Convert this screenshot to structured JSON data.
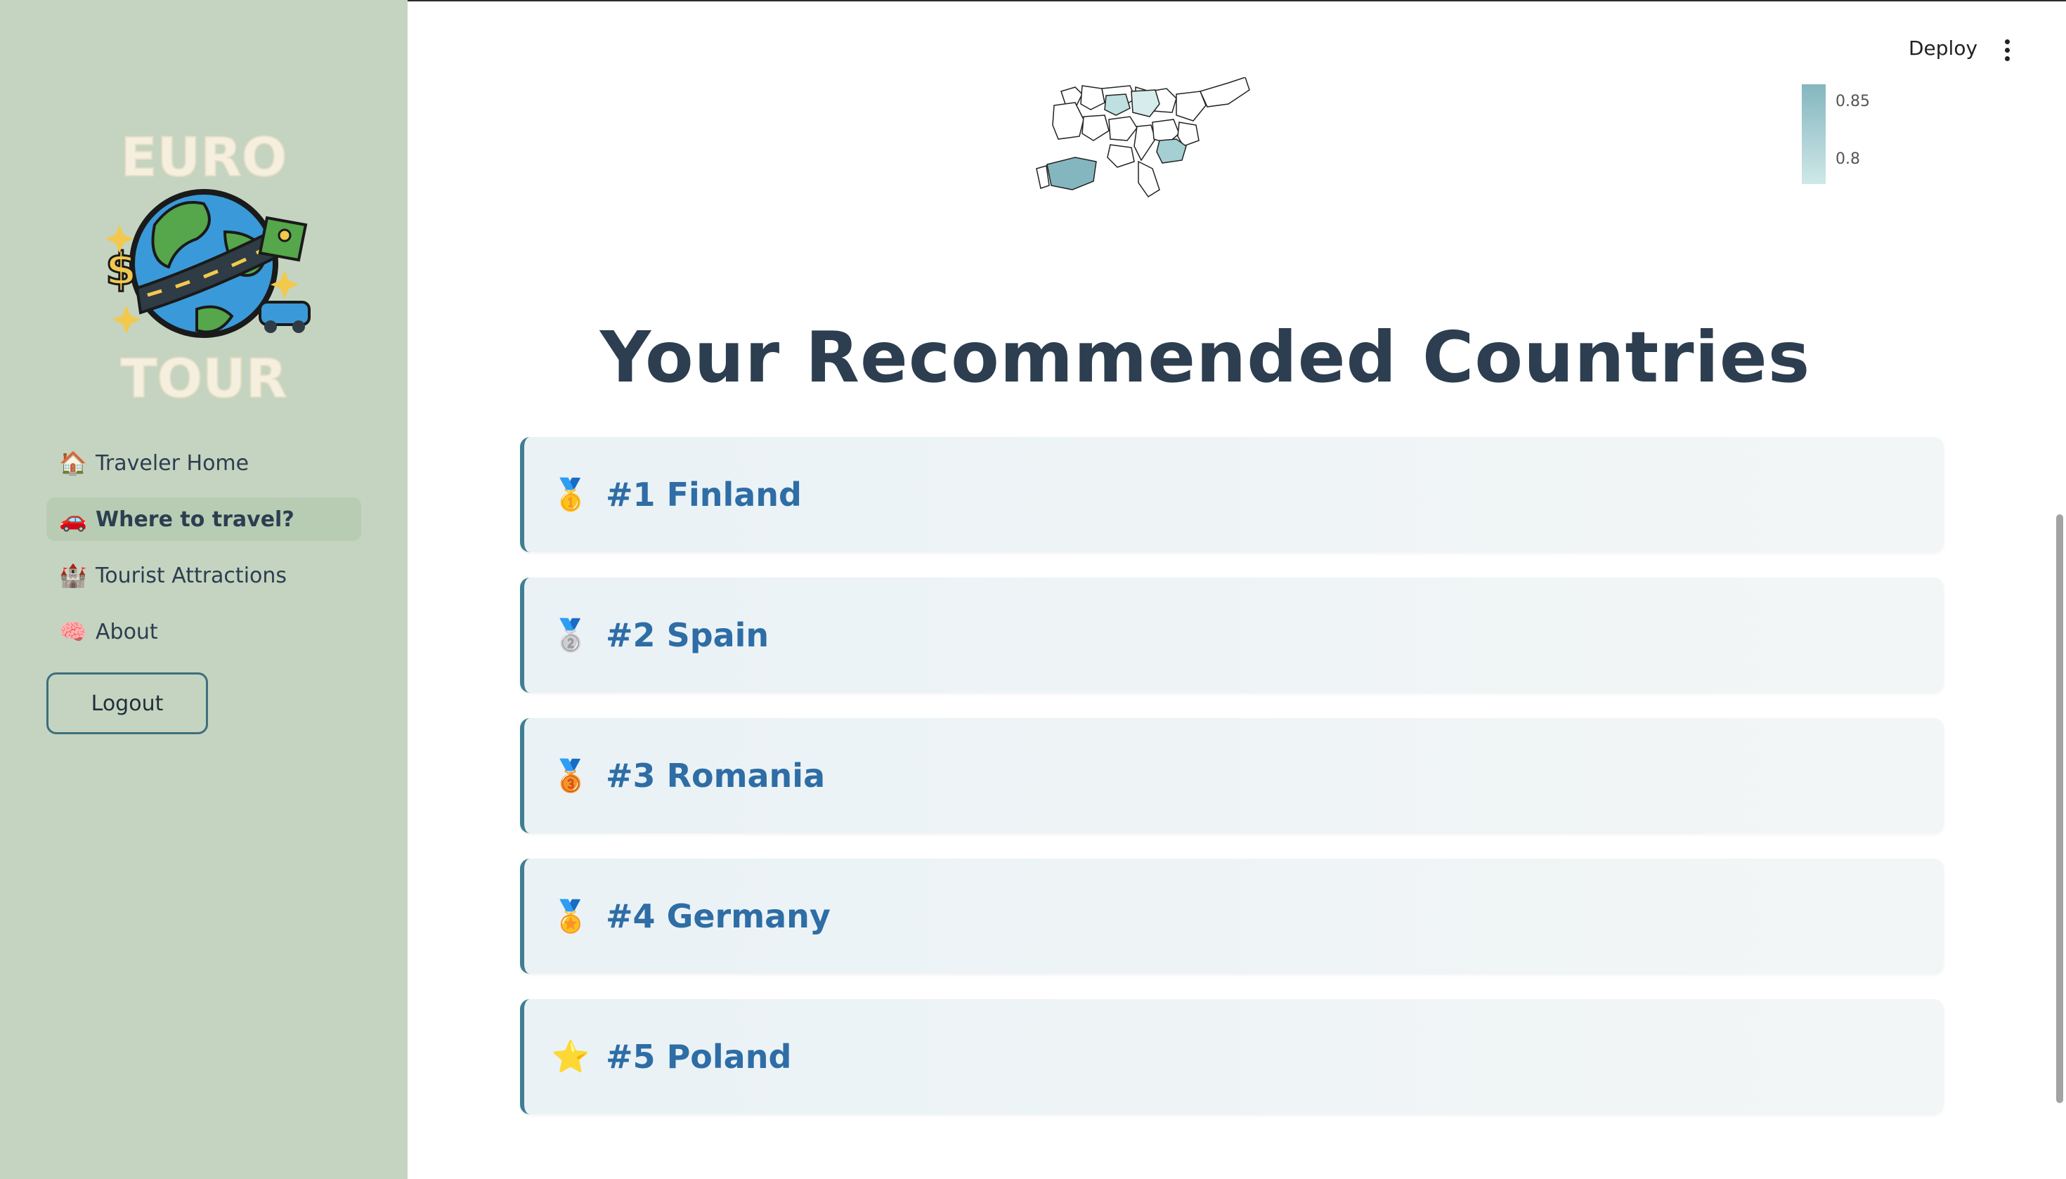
{
  "logo": {
    "top_text": "EURO",
    "bottom_text": "TOUR",
    "dollar_glyph": "$"
  },
  "sidebar": {
    "items": [
      {
        "emoji": "🏠",
        "label": "Traveler Home",
        "active": false
      },
      {
        "emoji": "🚗",
        "label": "Where to travel?",
        "active": true
      },
      {
        "emoji": "🏰",
        "label": "Tourist Attractions",
        "active": false
      },
      {
        "emoji": "🧠",
        "label": "About",
        "active": false
      }
    ],
    "logout_label": "Logout"
  },
  "header": {
    "deploy_label": "Deploy",
    "menu_icon": "kebab-menu-icon"
  },
  "map": {
    "legend_ticks": [
      "0.85",
      "0.8"
    ],
    "colors": {
      "high": "#84b6bf",
      "low": "#cfe8e8"
    }
  },
  "main": {
    "title": "Your Recommended Countries",
    "recommendations": [
      {
        "medal": "🥇",
        "label": "#1 Finland"
      },
      {
        "medal": "🥈",
        "label": "#2 Spain"
      },
      {
        "medal": "🥉",
        "label": "#3 Romania"
      },
      {
        "medal": "🏅",
        "label": "#4 Germany"
      },
      {
        "medal": "⭐",
        "label": "#5 Poland"
      }
    ]
  },
  "colors": {
    "sidebar_bg": "#c5d4c0",
    "title": "#2c3e50",
    "card_text": "#2e6da5",
    "card_border": "#3f7f92"
  }
}
